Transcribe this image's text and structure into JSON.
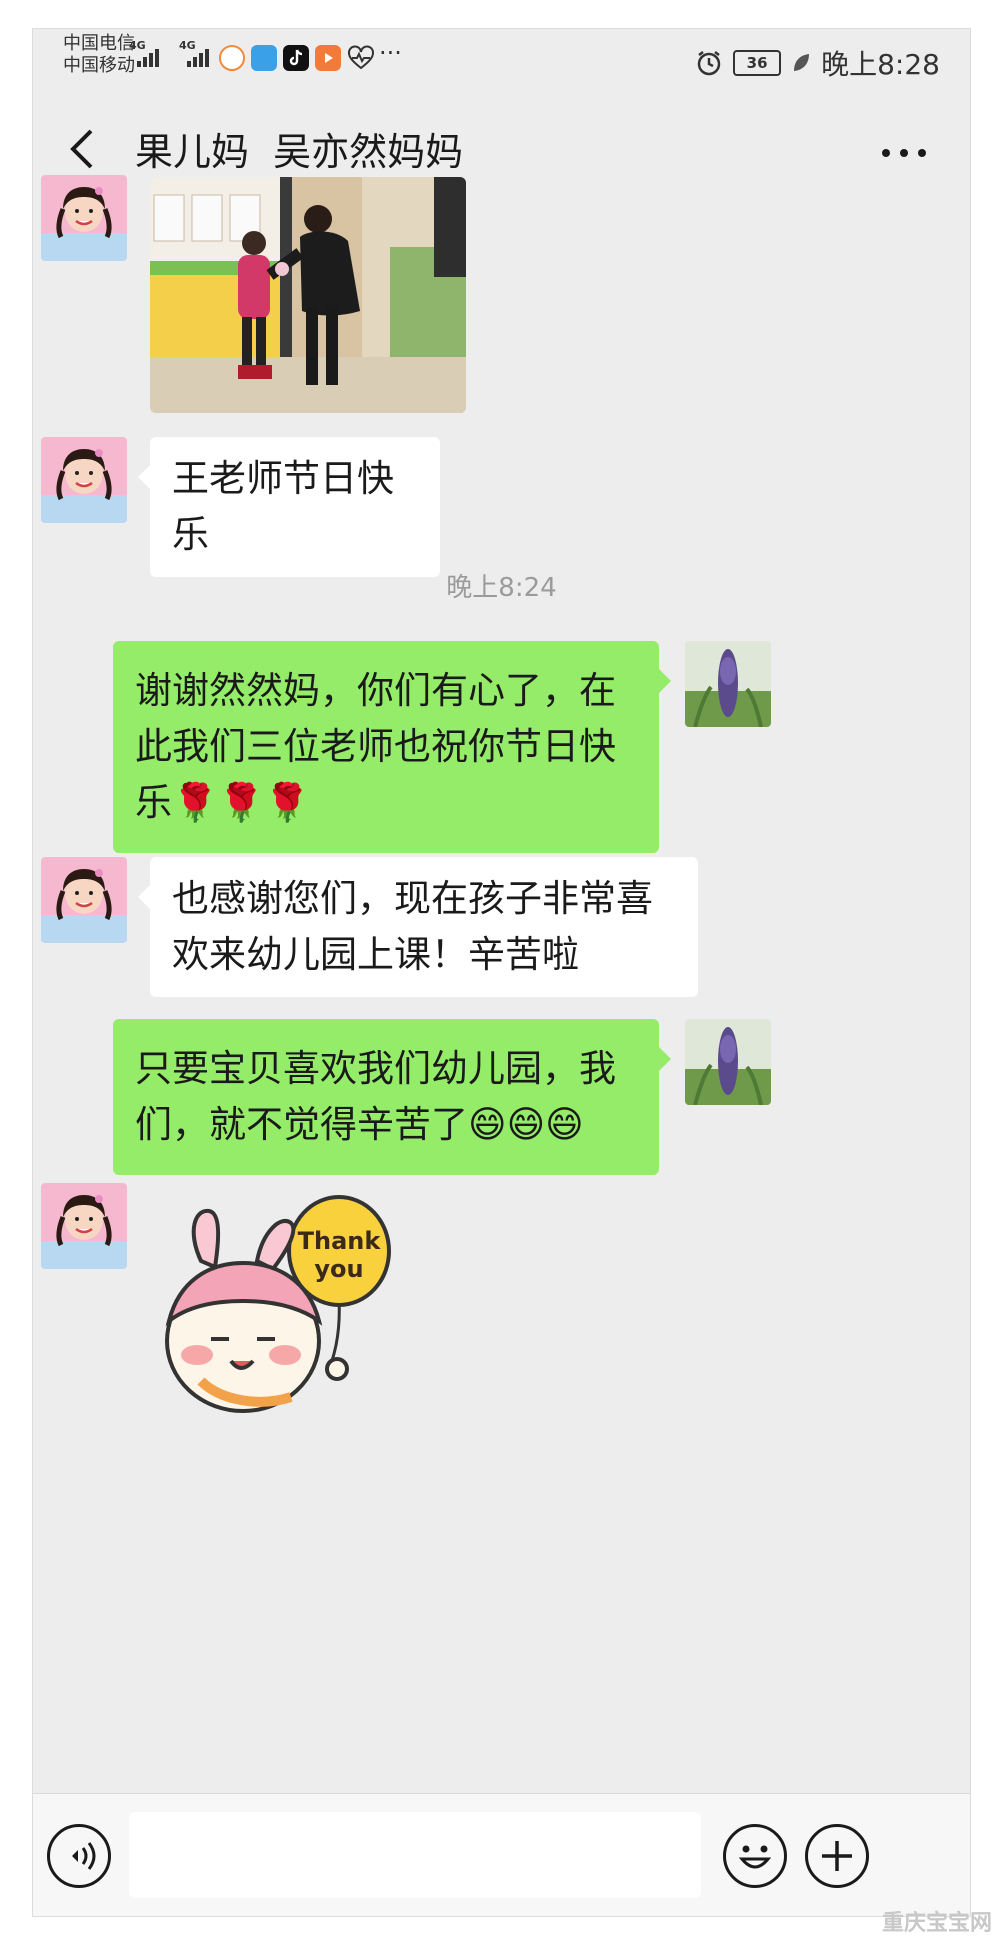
{
  "status_bar": {
    "carrier_1": "中国电信",
    "carrier_2": "中国移动",
    "net_1": "4G",
    "net_2": "4G",
    "battery": "36",
    "time": "晚上8:28",
    "more": "···"
  },
  "header": {
    "title": "果儿妈  吴亦然妈妈",
    "more": "···"
  },
  "chat": {
    "timestamp": "晚上8:24",
    "messages": [
      {
        "from": "other",
        "type": "image"
      },
      {
        "from": "other",
        "type": "text",
        "text": "王老师节日快乐"
      },
      {
        "from": "me",
        "type": "text",
        "text": "谢谢然然妈，你们有心了，在此我们三位老师也祝你节日快乐🌹🌹🌹"
      },
      {
        "from": "other",
        "type": "text",
        "text": " 也感谢您们，现在孩子非常喜欢来幼儿园上课！辛苦啦"
      },
      {
        "from": "me",
        "type": "text",
        "text": "只要宝贝喜欢我们幼儿园，我们，就不觉得辛苦了😄😄😄"
      },
      {
        "from": "other",
        "type": "sticker",
        "text": "Thank you"
      }
    ]
  },
  "input_bar": {
    "voice_icon": "voice-icon",
    "emoji_icon": "emoji-icon",
    "plus_icon": "plus-icon"
  },
  "watermark": "重庆宝宝网",
  "colors": {
    "background": "#ededed",
    "outgoing_bubble": "#95ec69",
    "incoming_bubble": "#ffffff"
  }
}
